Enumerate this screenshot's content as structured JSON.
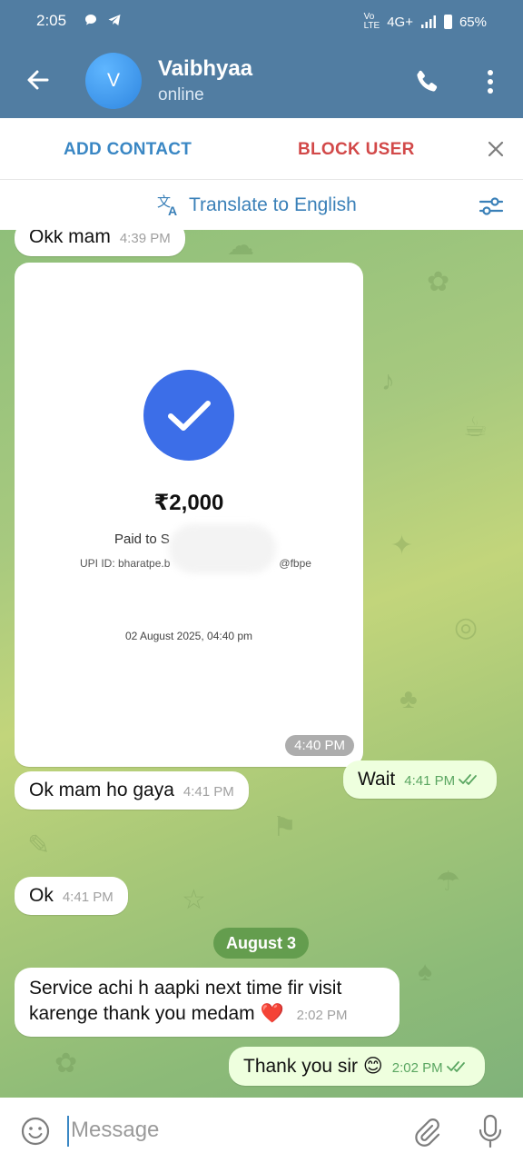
{
  "status_bar": {
    "time": "2:05",
    "network": "4G+",
    "battery": "65%"
  },
  "header": {
    "avatar_letter": "V",
    "name": "Vaibhyaa",
    "status": "online",
    "icons": {
      "back": "arrow-left-icon",
      "call": "phone-icon",
      "menu": "more-vert-icon"
    }
  },
  "action_bar": {
    "add_contact": "ADD CONTACT",
    "block_user": "BLOCK USER"
  },
  "translate_bar": {
    "label": "Translate to English"
  },
  "messages": [
    {
      "direction": "in",
      "text": "Okk mam",
      "time": "4:39 PM"
    },
    {
      "direction": "in",
      "type": "payment-image",
      "amount": "₹2,000",
      "paid_to": "Paid to S",
      "upi_id": "UPI ID: bharatpe.b",
      "upi_suffix": "@fbpe",
      "date": "02 August 2025, 04:40 pm",
      "time": "4:40 PM"
    },
    {
      "direction": "out",
      "text": "Wait",
      "time": "4:41 PM",
      "read": true
    },
    {
      "direction": "in",
      "text": "Ok mam ho gaya",
      "time": "4:41 PM"
    },
    {
      "direction": "in",
      "text": "Ok",
      "time": "4:41 PM"
    },
    {
      "direction": "in",
      "text": "Service achi h aapki next time fir visit",
      "text2": "karenge thank you medam ❤️",
      "time": "2:02 PM"
    },
    {
      "direction": "out",
      "text": "Thank you sir 😊",
      "time": "2:02 PM",
      "read": true
    }
  ],
  "date_divider": "August 3",
  "input_bar": {
    "placeholder": "Message"
  },
  "colors": {
    "header": "#517da2",
    "accent": "#3a87c4",
    "danger": "#d24949",
    "outgoing_bubble": "#eeffde",
    "read_ticks": "#5aa661",
    "payment_check": "#3c6ee8"
  }
}
